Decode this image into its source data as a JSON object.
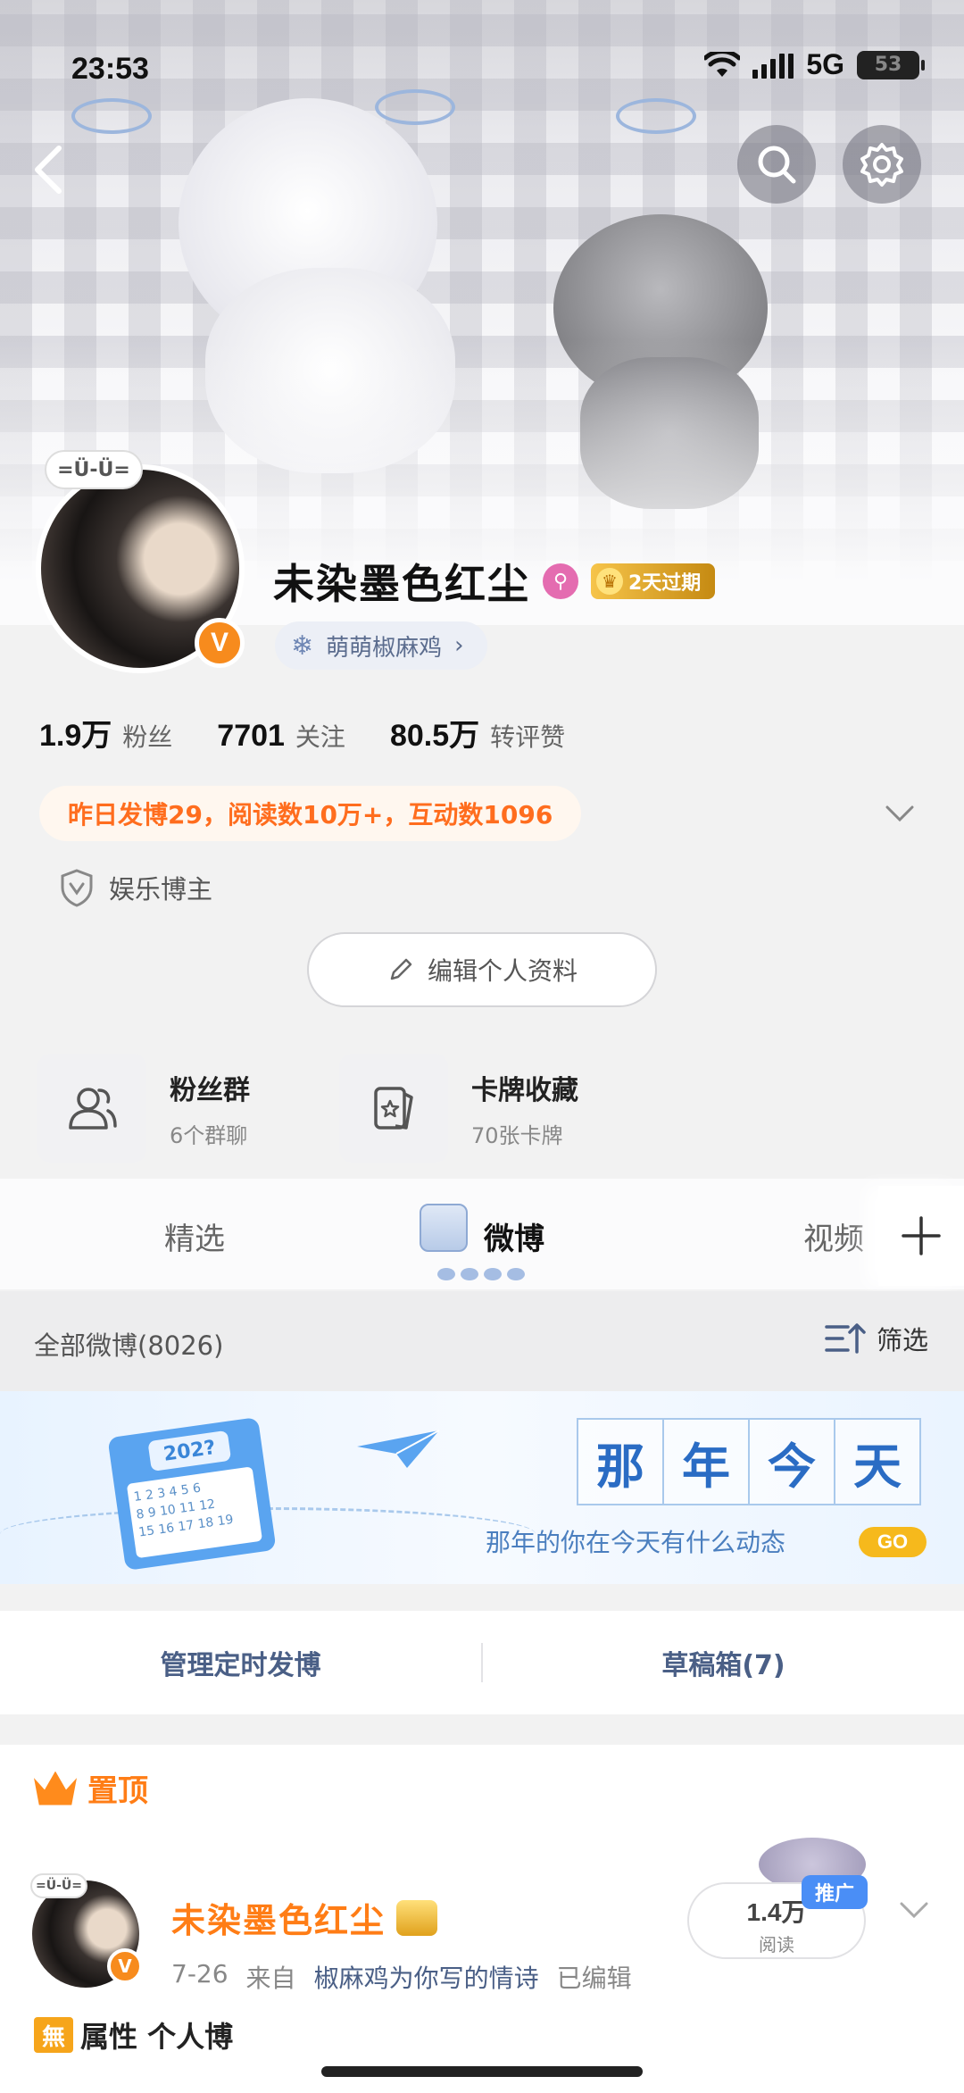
{
  "status_bar": {
    "time": "23:53",
    "network": "5G",
    "battery": "53"
  },
  "profile": {
    "avatar_sticker": "=Ü-Ü=",
    "verified_badge": "V",
    "name": "未染墨色红尘",
    "vip_badge": "2天过期",
    "fan_club": "萌萌椒麻鸡",
    "stats": [
      {
        "value": "1.9万",
        "label": "粉丝"
      },
      {
        "value": "7701",
        "label": "关注"
      },
      {
        "value": "80.5万",
        "label": "转评赞"
      }
    ],
    "activity": "昨日发博29，阅读数10万+，互动数1096",
    "identity": "娱乐博主",
    "edit_button": "编辑个人资料"
  },
  "cards": [
    {
      "title": "粉丝群",
      "subtitle": "6个群聊",
      "icon": "group-icon"
    },
    {
      "title": "卡牌收藏",
      "subtitle": "70张卡牌",
      "icon": "card-icon"
    }
  ],
  "tabs": [
    {
      "label": "精选"
    },
    {
      "label": "微博",
      "active": true
    },
    {
      "label": "视频"
    }
  ],
  "feed": {
    "all_posts": "全部微博(8026)",
    "filter": "筛选"
  },
  "memory_banner": {
    "calendar_year": "202?",
    "title_chars": [
      "那",
      "年",
      "今",
      "天"
    ],
    "subtitle": "那年的你在今天有什么动态",
    "go": "GO"
  },
  "actions": {
    "scheduled": "管理定时发博",
    "drafts": "草稿箱(7)"
  },
  "pinned_post": {
    "pin_label": "置顶",
    "author": "未染墨色红尘",
    "date": "7-26",
    "from_prefix": "来自",
    "source": "椒麻鸡为你写的情诗",
    "edited": "已编辑",
    "reads_value": "1.4万",
    "reads_label": "阅读",
    "promo": "推广",
    "body_tag": "無",
    "body_text": "属性 个人博"
  },
  "colors": {
    "accent_orange": "#ff7d16",
    "link_blue": "#4a5f86",
    "vip_gold": "#f6c44a",
    "memory_blue": "#2a6cc4"
  }
}
